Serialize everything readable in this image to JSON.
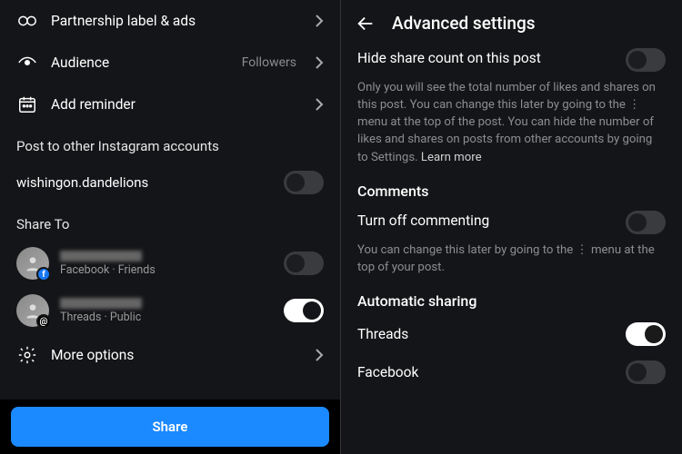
{
  "left": {
    "menu": {
      "partnership_label": "Partnership label & ads",
      "audience_label": "Audience",
      "audience_value": "Followers",
      "reminder_label": "Add reminder"
    },
    "post_to_header": "Post to other Instagram accounts",
    "other_account": "wishingon.dandelions",
    "share_to_header": "Share To",
    "share_targets": [
      {
        "subtitle": "Facebook · Friends",
        "badge": "fb",
        "on": false
      },
      {
        "subtitle": "Threads · Public",
        "badge": "th",
        "on": true
      }
    ],
    "more_options": "More options",
    "share_button": "Share"
  },
  "right": {
    "title": "Advanced settings",
    "hide_share": {
      "title": "Hide share count on this post",
      "desc_a": "Only you will see the total number of likes and shares on this post. You can change this later by going to the  ⋮  menu at the top of the post. You can hide the number of likes and shares on posts from other accounts by going to Settings. ",
      "learn_more": "Learn more",
      "on": false
    },
    "comments_header": "Comments",
    "turn_off_commenting": {
      "title": "Turn off commenting",
      "desc": "You can change this later by going to the  ⋮  menu at the top of your post.",
      "on": false
    },
    "auto_sharing_header": "Automatic sharing",
    "threads": {
      "label": "Threads",
      "on": true
    },
    "facebook": {
      "label": "Facebook",
      "on": false
    }
  }
}
